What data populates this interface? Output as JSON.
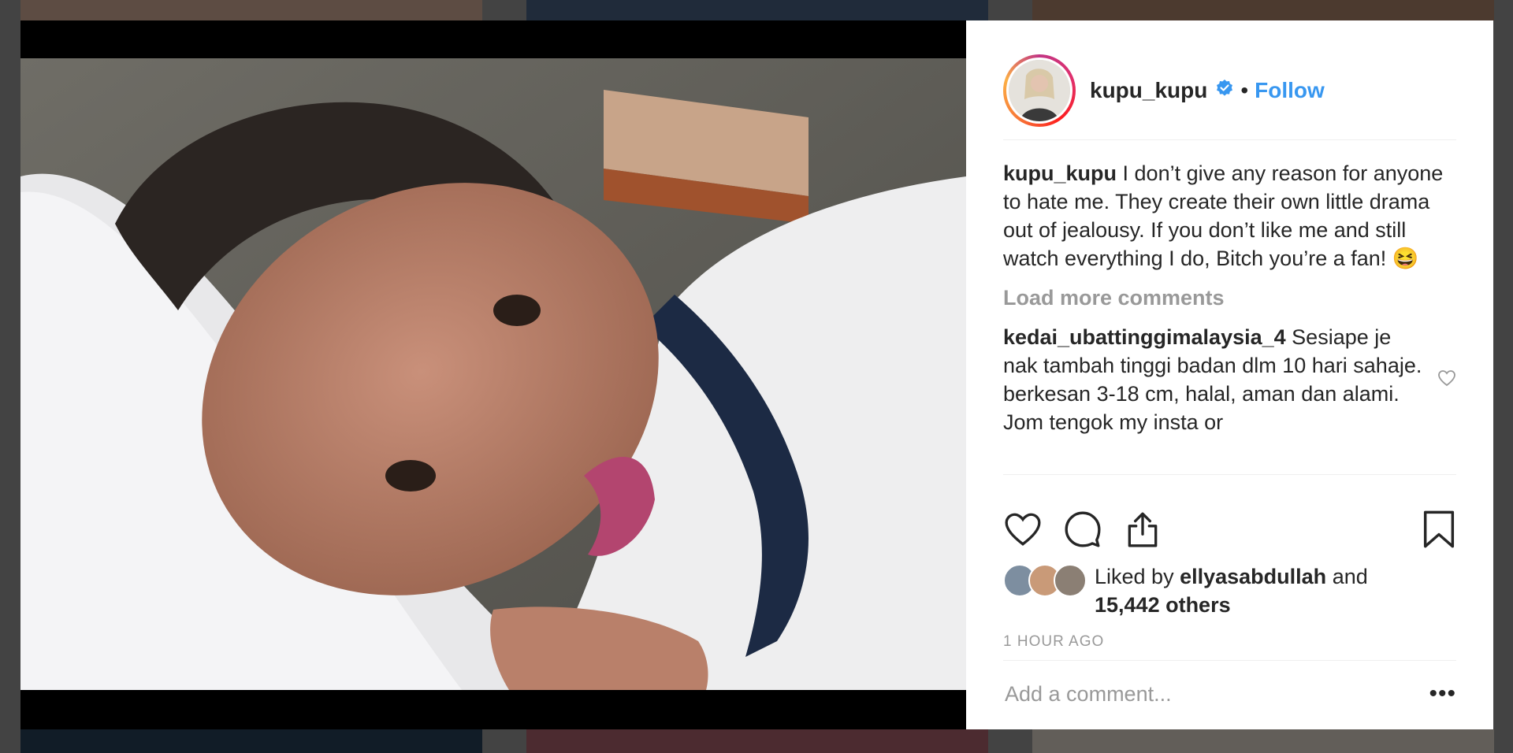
{
  "post": {
    "username": "kupu_kupu",
    "dot": "•",
    "follow_label": "Follow",
    "caption": {
      "user": "kupu_kupu",
      "text": "I don’t give any reason for anyone to hate me. They create their own little drama out of jealousy. If you don’t like me and still watch everything I do, Bitch you’re a fan! 😆"
    },
    "load_more": "Load more comments",
    "comments": [
      {
        "user": "kedai_ubattinggimalaysia_4",
        "text": "Sesiape je nak tambah tinggi badan dlm 10 hari sahaje. berkesan 3-18 cm, halal, aman dan alami. Jom tengok my insta or"
      }
    ],
    "likes": {
      "prefix": "Liked by",
      "user": "ellyasabdullah",
      "and": "and",
      "others": "15,442 others"
    },
    "time": "1 HOUR AGO",
    "add_comment_placeholder": "Add a comment...",
    "more_label": "•••"
  },
  "colors": {
    "accent": "#3897f0",
    "text": "#262626",
    "muted": "#999999"
  },
  "icons": [
    "verified-badge-icon",
    "heart-icon",
    "comment-icon",
    "share-icon",
    "bookmark-icon",
    "small-heart-icon",
    "more-options-icon"
  ]
}
